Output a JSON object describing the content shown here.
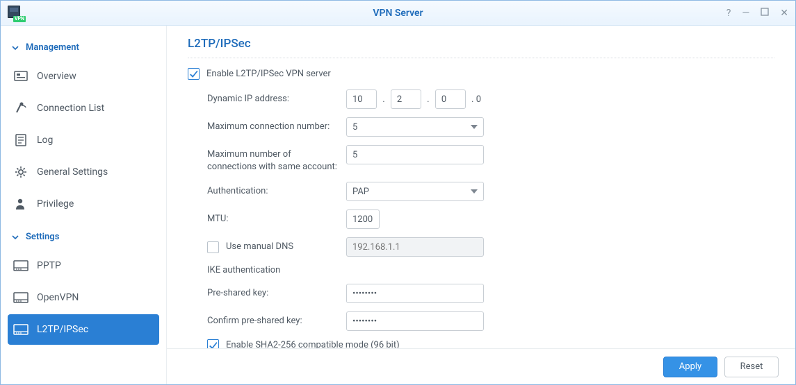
{
  "window": {
    "title": "VPN Server",
    "icon_badge": "VPN"
  },
  "sidebar": {
    "sections": [
      {
        "header": "Management",
        "items": [
          {
            "id": "overview",
            "label": "Overview"
          },
          {
            "id": "connection-list",
            "label": "Connection List"
          },
          {
            "id": "log",
            "label": "Log"
          },
          {
            "id": "general-settings",
            "label": "General Settings"
          },
          {
            "id": "privilege",
            "label": "Privilege"
          }
        ]
      },
      {
        "header": "Settings",
        "items": [
          {
            "id": "pptp",
            "label": "PPTP"
          },
          {
            "id": "openvpn",
            "label": "OpenVPN"
          },
          {
            "id": "l2tp-ipsec",
            "label": "L2TP/IPSec",
            "active": true
          }
        ]
      }
    ]
  },
  "main": {
    "title": "L2TP/IPSec",
    "enable": {
      "checked": true,
      "label": "Enable L2TP/IPSec VPN server"
    },
    "dynamic_ip": {
      "label": "Dynamic IP address:",
      "octet1": "10",
      "octet2": "2",
      "octet3": "0",
      "octet4_static": ". 0"
    },
    "max_conn": {
      "label": "Maximum connection number:",
      "value": "5"
    },
    "max_conn_same": {
      "label": "Maximum number of connections with same account:",
      "value": "5"
    },
    "auth": {
      "label": "Authentication:",
      "value": "PAP"
    },
    "mtu": {
      "label": "MTU:",
      "value": "1200"
    },
    "manual_dns": {
      "checked": false,
      "label": "Use manual DNS",
      "placeholder": "192.168.1.1"
    },
    "ike_header": "IKE authentication",
    "psk": {
      "label": "Pre-shared key:",
      "value": "••••••••"
    },
    "psk_confirm": {
      "label": "Confirm pre-shared key:",
      "value": "••••••••"
    },
    "sha2": {
      "checked": true,
      "label": "Enable SHA2-256 compatible mode (96 bit)"
    }
  },
  "footer": {
    "apply": "Apply",
    "reset": "Reset"
  }
}
